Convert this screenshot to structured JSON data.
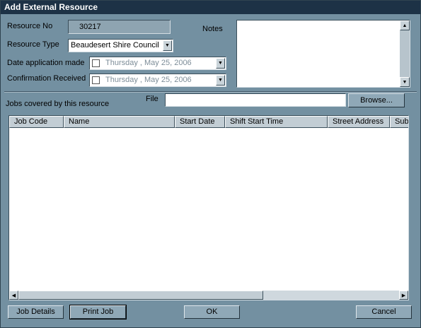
{
  "window": {
    "title": "Add External Resource"
  },
  "form": {
    "resource_no_label": "Resource No",
    "resource_no_value": "30217",
    "resource_type_label": "Resource Type",
    "resource_type_value": "Beaudesert Shire Council",
    "date_app_label": "Date application made",
    "date_app_value": "Thursday  , May 25, 2006",
    "confirm_label": "Confirmation Received",
    "confirm_value": "Thursday  , May 25, 2006",
    "notes_label": "Notes",
    "jobs_label": "Jobs covered by this resource",
    "file_label": "File",
    "file_value": "",
    "browse_label": "Browse..."
  },
  "grid": {
    "columns": [
      "Job Code",
      "Name",
      "Start Date",
      "Shift Start Time",
      "Street Address",
      "Sub"
    ],
    "rows": []
  },
  "buttons": {
    "job_details": "Job Details",
    "print_job": "Print Job",
    "ok": "OK",
    "cancel": "Cancel"
  },
  "icons": {
    "dropdown": "chevron-down-icon",
    "scroll_up": "arrow-up-icon",
    "scroll_down": "arrow-down-icon",
    "scroll_left": "arrow-left-icon",
    "scroll_right": "arrow-right-icon"
  },
  "colors": {
    "title_bar": "#1d3246",
    "window_bg": "#7390a1"
  }
}
